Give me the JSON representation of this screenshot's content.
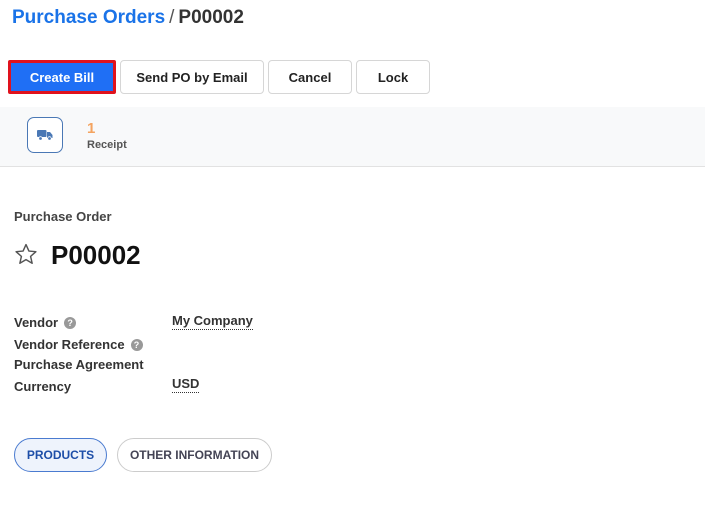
{
  "breadcrumb": {
    "parent": "Purchase Orders",
    "separator": "/",
    "current": "P00002"
  },
  "toolbar": {
    "create_bill": "Create Bill",
    "send_po_email": "Send PO by Email",
    "cancel": "Cancel",
    "lock": "Lock"
  },
  "smart_buttons": {
    "receipt_count": "1",
    "receipt_label": "Receipt",
    "icon": "truck-icon"
  },
  "form": {
    "type_label": "Purchase Order",
    "name": "P00002",
    "fields": {
      "vendor": {
        "label": "Vendor",
        "value": "My Company"
      },
      "vendor_reference": {
        "label": "Vendor Reference",
        "value": ""
      },
      "purchase_agreement": {
        "label": "Purchase Agreement",
        "value": ""
      },
      "currency": {
        "label": "Currency",
        "value": "USD"
      }
    },
    "help_glyph": "?"
  },
  "tabs": {
    "products": "PRODUCTS",
    "other_information": "OTHER INFORMATION"
  },
  "colors": {
    "primary": "#1f6ff5",
    "highlight": "#e0121d",
    "link": "#1a73e8",
    "receipt_count": "#f4a460"
  }
}
